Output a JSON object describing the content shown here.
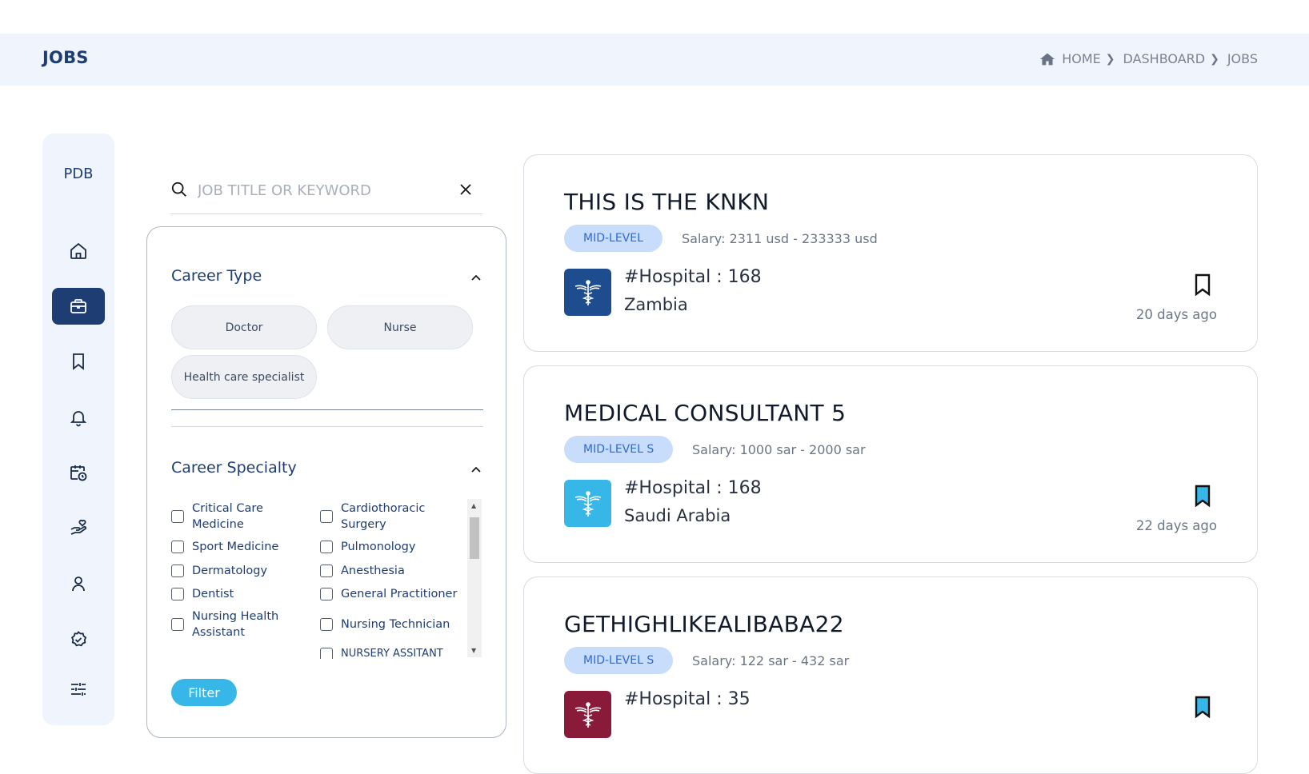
{
  "header": {
    "title": "JOBS",
    "breadcrumb": [
      "HOME",
      "DASHBOARD",
      "JOBS"
    ]
  },
  "sidebar": {
    "logo": "PDB",
    "items": [
      {
        "name": "home",
        "icon": "home-icon",
        "active": false
      },
      {
        "name": "jobs",
        "icon": "briefcase-icon",
        "active": true
      },
      {
        "name": "saved",
        "icon": "bookmark-icon",
        "active": false
      },
      {
        "name": "notifications",
        "icon": "bell-icon",
        "active": false
      },
      {
        "name": "schedule",
        "icon": "calendar-clock-icon",
        "active": false
      },
      {
        "name": "services",
        "icon": "hand-heart-icon",
        "active": false
      },
      {
        "name": "profile",
        "icon": "user-icon",
        "active": false
      },
      {
        "name": "verified",
        "icon": "check-circle-icon",
        "active": false
      },
      {
        "name": "settings",
        "icon": "sliders-icon",
        "active": false
      }
    ]
  },
  "search": {
    "placeholder": "JOB TITLE OR KEYWORD",
    "value": ""
  },
  "filters": {
    "career_type": {
      "title": "Career Type",
      "options": [
        "Doctor",
        "Nurse",
        "Health care specialist"
      ]
    },
    "career_specialty": {
      "title": "Career Specialty",
      "options": [
        "Critical Care Medicine",
        "Cardiothoracic Surgery",
        "Sport Medicine",
        "Pulmonology",
        "Dermatology",
        "Anesthesia",
        "Dentist",
        "General Practitioner",
        "Nursing Health Assistant",
        "Nursing Technician",
        "NURSERY ASSITANT"
      ]
    },
    "filter_button": "Filter"
  },
  "jobs": [
    {
      "title": "THIS IS THE KNKN",
      "level": "MID-LEVEL",
      "salary": "Salary: 2311 usd - 233333 usd",
      "hospital": "#Hospital : 168",
      "country": "Zambia",
      "posted": "20 days ago",
      "logo_color": "#1e4d8f",
      "bookmarked": false
    },
    {
      "title": "MEDICAL CONSULTANT 5",
      "level": "MID-LEVEL S",
      "salary": "Salary: 1000 sar - 2000 sar",
      "hospital": "#Hospital : 168",
      "country": "Saudi Arabia",
      "posted": "22 days ago",
      "logo_color": "#36b7e8",
      "bookmarked": true
    },
    {
      "title": "GETHIGHLIKEALIBABA22",
      "level": "MID-LEVEL S",
      "salary": "Salary: 122 sar - 432 sar",
      "hospital": "#Hospital : 35",
      "country": "",
      "posted": "",
      "logo_color": "#8a1a3a",
      "bookmarked": true
    }
  ]
}
